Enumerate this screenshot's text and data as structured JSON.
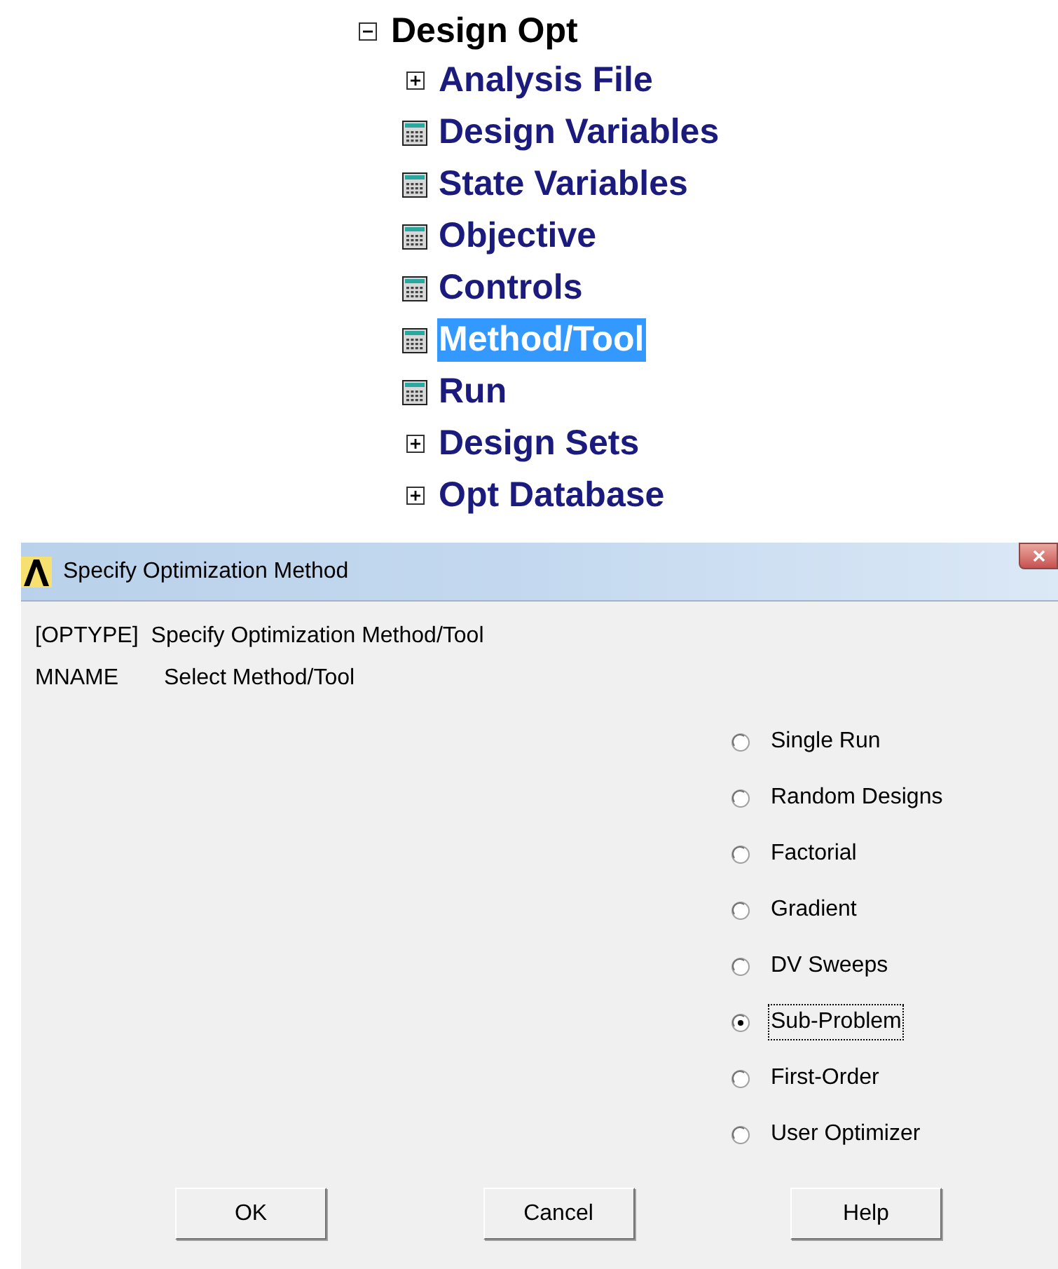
{
  "tree": {
    "label": "Design Opt",
    "expanded": true,
    "children": [
      {
        "label": "Analysis File",
        "kind": "folder",
        "expanded": false,
        "selected": false
      },
      {
        "label": "Design Variables",
        "kind": "dialog",
        "selected": false
      },
      {
        "label": "State Variables",
        "kind": "dialog",
        "selected": false
      },
      {
        "label": "Objective",
        "kind": "dialog",
        "selected": false
      },
      {
        "label": "Controls",
        "kind": "dialog",
        "selected": false
      },
      {
        "label": "Method/Tool",
        "kind": "dialog",
        "selected": true
      },
      {
        "label": "Run",
        "kind": "dialog",
        "selected": false
      },
      {
        "label": "Design Sets",
        "kind": "folder",
        "expanded": false,
        "selected": false
      },
      {
        "label": "Opt Database",
        "kind": "folder",
        "expanded": false,
        "selected": false
      }
    ]
  },
  "dialog": {
    "title": "Specify Optimization Method",
    "command_line": {
      "key": "[OPTYPE]",
      "text": "Specify Optimization Method/Tool"
    },
    "field_line": {
      "key": "MNAME",
      "text": "Select Method/Tool"
    },
    "options": [
      {
        "label": "Single Run",
        "selected": false
      },
      {
        "label": "Random Designs",
        "selected": false
      },
      {
        "label": "Factorial",
        "selected": false
      },
      {
        "label": "Gradient",
        "selected": false
      },
      {
        "label": "DV Sweeps",
        "selected": false
      },
      {
        "label": "Sub-Problem",
        "selected": true
      },
      {
        "label": "First-Order",
        "selected": false
      },
      {
        "label": "User Optimizer",
        "selected": false
      }
    ],
    "buttons": [
      "OK",
      "Cancel",
      "Help"
    ]
  }
}
